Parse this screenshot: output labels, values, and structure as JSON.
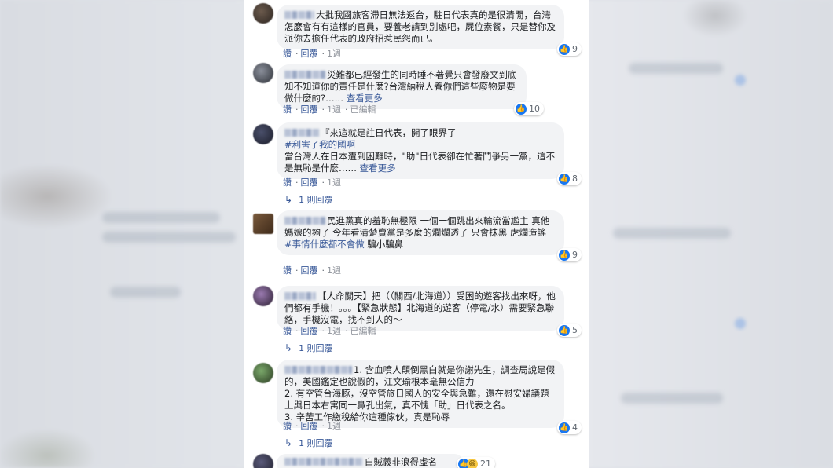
{
  "comments": [
    {
      "text": "大批我國旅客滯日無法返台，駐日代表真的是很清閒，台灣怎麼會有有這樣的官員，要養老請到別處吧，屍位素餐，只是替你及派你去擔任代表的政府招惹民怨而已。",
      "likes": "9",
      "actions": {
        "like": "讚",
        "reply": "回覆",
        "time": "1週",
        "edited": ""
      }
    },
    {
      "text": "災難都已經發生的同時睡不著覺只會發廢文到底知不知道你的責任是什麼?台灣納稅人養你們這些廢物是要做什麼的?……",
      "more": "查看更多",
      "likes": "10",
      "actions": {
        "like": "讚",
        "reply": "回覆",
        "time": "1週",
        "edited": "已編輯"
      }
    },
    {
      "text": "『來這就是註日代表，開了眼界了",
      "hashtag": "#利害了我的國啊",
      "text2": "當台灣人在日本遭到困難時，\"助\"日代表卻在忙著鬥爭另一黨，這不是無恥是什麼……",
      "more": "查看更多",
      "likes": "8",
      "actions": {
        "like": "讚",
        "reply": "回覆",
        "time": "1週",
        "edited": ""
      },
      "replies": "1 則回覆"
    },
    {
      "text": "民進黨真的羞恥無極限 一個一個跳出來輪流當尷主 真他媽娘的夠了 今年看清楚賣黨是多麼的爛爛透了 只會抹黑 虎爛造謠",
      "hashtag": "#事情什麼都不會做",
      "text2": "騙小騙鼻",
      "likes": "9",
      "actions": {
        "like": "讚",
        "reply": "回覆",
        "time": "1週",
        "edited": ""
      }
    },
    {
      "text": "【人命關天】把（（關西/北海道））受困的遊客找出來呀，他們都有手機！。。。【緊急狀態】北海道的遊客（停電/水）需要緊急聯絡，手機沒電，找不到人的～",
      "likes": "5",
      "actions": {
        "like": "讚",
        "reply": "回覆",
        "time": "1週",
        "edited": "已編輯"
      },
      "replies": "1 則回覆"
    },
    {
      "text": "1. 含血噴人顛倒黑白就是你謝先生，調查局說是假的，美國鑑定也說假的，江文瑜根本毫無公信力",
      "text2": "2. 有空管台海豚，沒空管旅日國人的安全與急難，還在慰安婦議題上與日本右寓同一鼻孔出氣，真不愧「助」日代表之名。",
      "text3": "3. 辛苦工作繳稅給你這種傢伙，真是恥辱",
      "likes": "4",
      "actions": {
        "like": "讚",
        "reply": "回覆",
        "time": "1週",
        "edited": ""
      },
      "replies": "1 則回覆"
    },
    {
      "text": "白賊義非浪得虛名",
      "likes": "21"
    }
  ]
}
